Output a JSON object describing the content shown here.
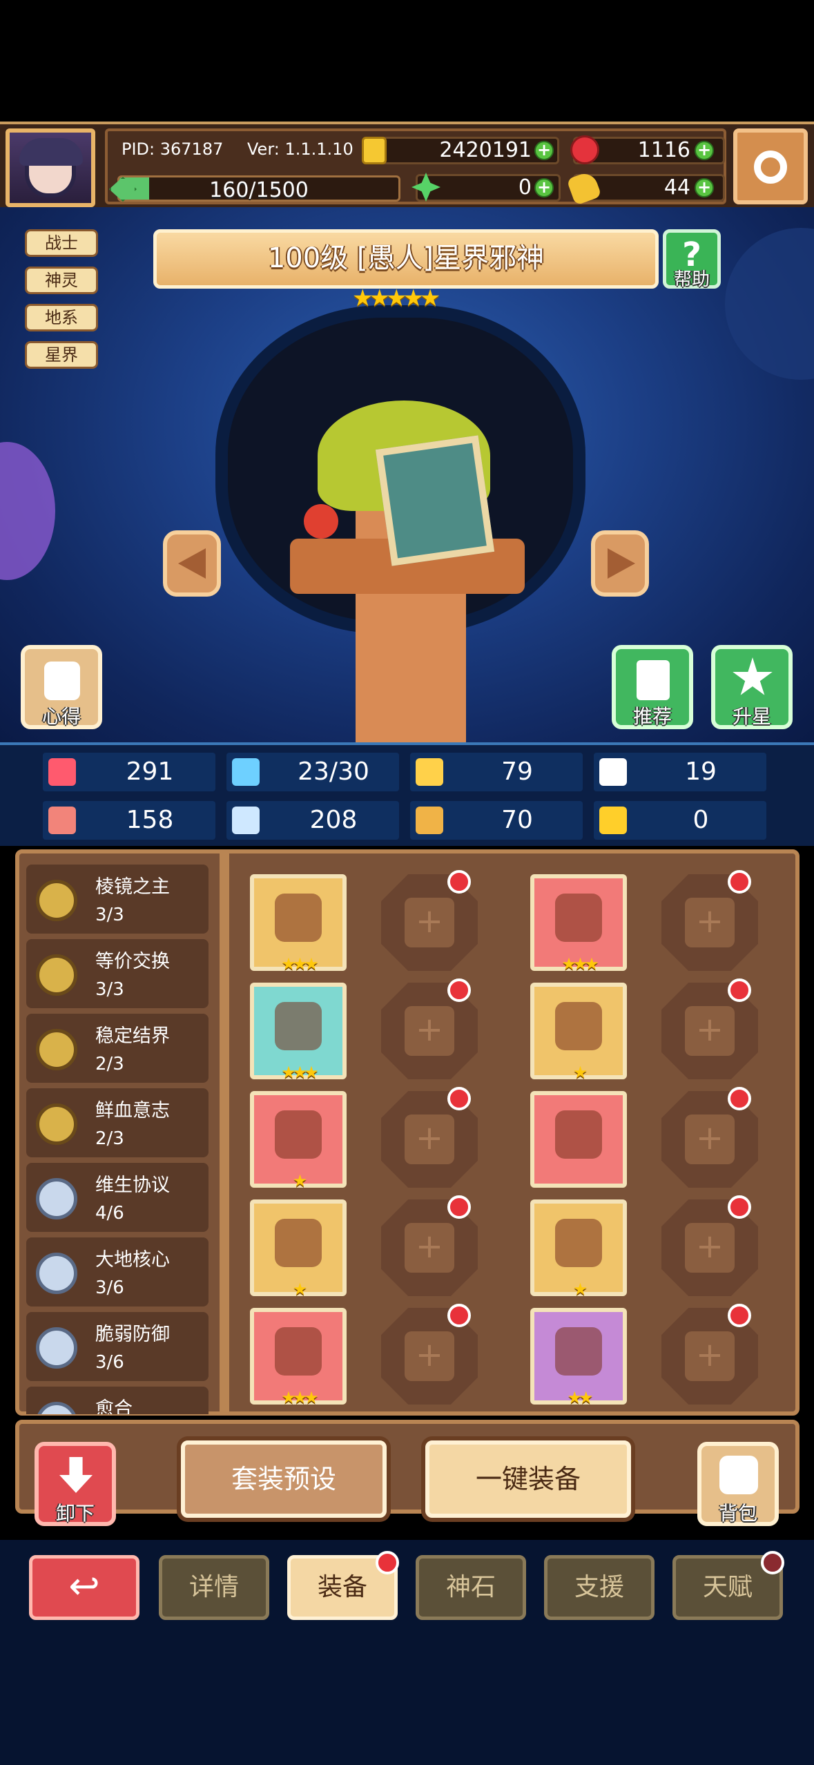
{
  "header": {
    "pid": "PID: 367187",
    "ver": "Ver: 1.1.1.10",
    "gold": "2420191",
    "gems": "1116",
    "energy": "160/1500",
    "energy_fraction": 0.107,
    "clover": "0",
    "key": "44"
  },
  "class_tags": [
    "战士",
    "神灵",
    "地系",
    "星界"
  ],
  "hero": {
    "title": "100级 [愚人]星界邪神",
    "stars": 5
  },
  "buttons": {
    "help": "帮助",
    "insight": "心得",
    "recommend": "推荐",
    "star_up": "升星",
    "unequip": "卸下",
    "bag": "背包",
    "preset": "套装预设",
    "equip_all": "一键装备"
  },
  "stats": [
    {
      "icon": "heart-icon",
      "value": "291"
    },
    {
      "icon": "drop-icon",
      "value": "23/30"
    },
    {
      "icon": "shield-icon",
      "value": "79"
    },
    {
      "icon": "wing-icon",
      "value": "19"
    },
    {
      "icon": "fist-icon",
      "value": "158"
    },
    {
      "icon": "book-icon",
      "value": "208"
    },
    {
      "icon": "boot-icon",
      "value": "70"
    },
    {
      "icon": "magnet-icon",
      "value": "0"
    }
  ],
  "sets": [
    {
      "name": "棱镜之主",
      "count": "3/3"
    },
    {
      "name": "等价交换",
      "count": "3/3"
    },
    {
      "name": "稳定结界",
      "count": "2/3"
    },
    {
      "name": "鲜血意志",
      "count": "2/3"
    },
    {
      "name": "维生协议",
      "count": "4/6"
    },
    {
      "name": "大地核心",
      "count": "3/6"
    },
    {
      "name": "脆弱防御",
      "count": "3/6"
    },
    {
      "name": "愈合",
      "count": ""
    }
  ],
  "equip_rows": [
    [
      {
        "item": "sword-icon",
        "bg": "#f0c46a",
        "stars": "★★★"
      },
      {
        "empty": true
      },
      {
        "item": "helmet-icon",
        "bg": "#f27a78",
        "stars": "★★★"
      },
      {
        "empty": true
      }
    ],
    [
      {
        "item": "shell-icon",
        "bg": "#7fd8d0",
        "stars": "★★★"
      },
      {
        "empty": true
      },
      {
        "item": "armor-icon",
        "bg": "#f0c46a",
        "stars": "★"
      },
      {
        "empty": true
      }
    ],
    [
      {
        "item": "vest-icon",
        "bg": "#f27a78",
        "stars": "★"
      },
      {
        "empty": true
      },
      {
        "item": "lung-icon",
        "bg": "#f27a78",
        "stars": ""
      },
      {
        "empty": true
      }
    ],
    [
      {
        "item": "scroll-icon",
        "bg": "#f0c46a",
        "stars": "★"
      },
      {
        "empty": true
      },
      {
        "item": "collar-icon",
        "bg": "#f0c46a",
        "stars": "★"
      },
      {
        "empty": true
      }
    ],
    [
      {
        "item": "pot-icon",
        "bg": "#f27a78",
        "stars": "★★★"
      },
      {
        "empty": true
      },
      {
        "item": "boots-icon",
        "bg": "#c58ad6",
        "stars": "★★"
      },
      {
        "empty": true
      }
    ]
  ],
  "tabs": [
    "详情",
    "装备",
    "神石",
    "支援",
    "天赋"
  ],
  "colors": {
    "accent": "#f4d7a4",
    "red_dot": "#e8323a",
    "star": "#ffc80a"
  }
}
